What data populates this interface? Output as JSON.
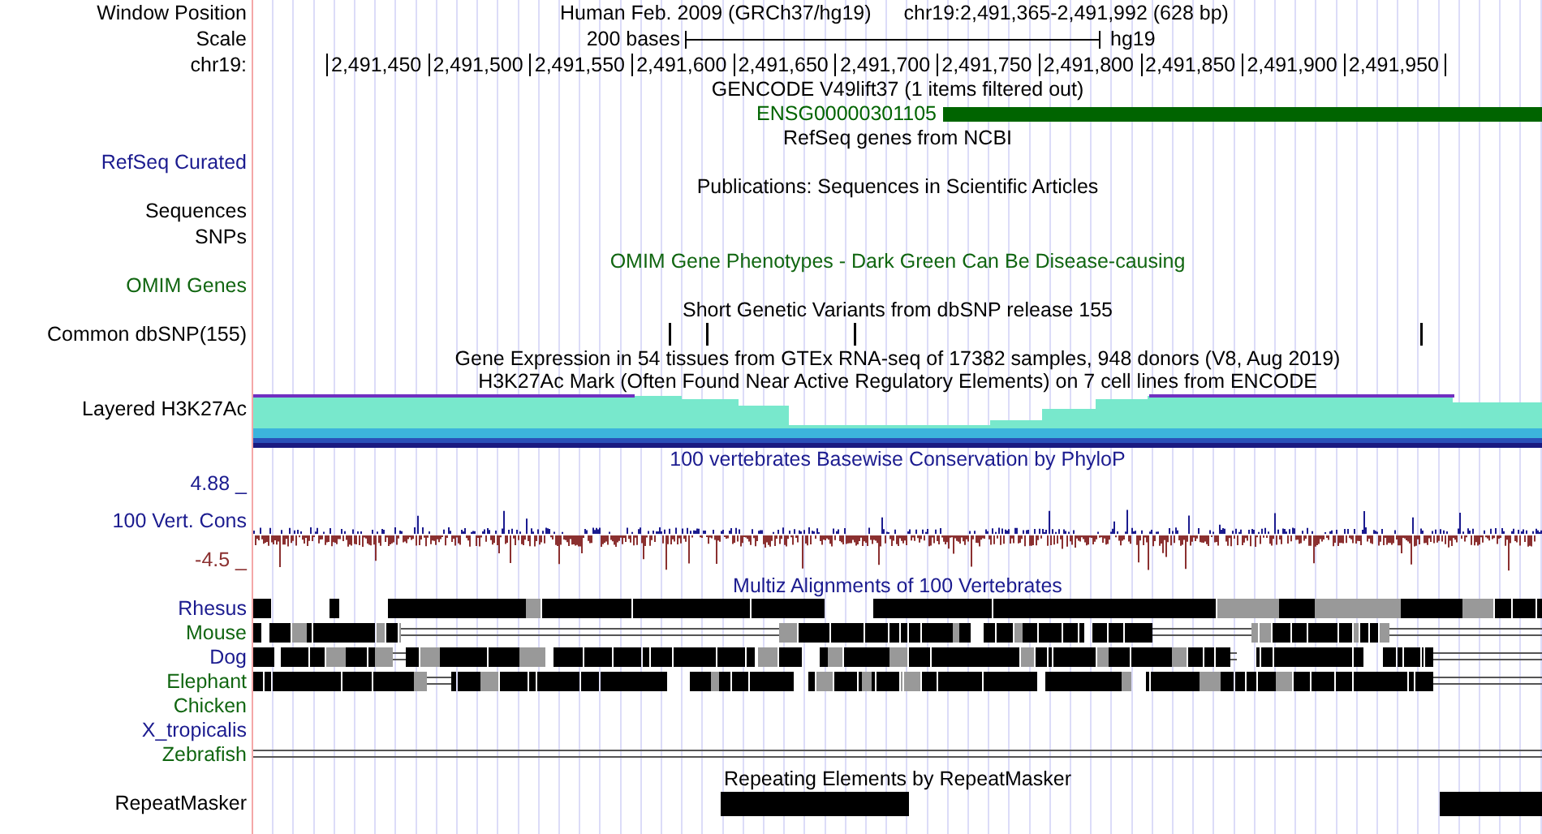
{
  "header": {
    "label": "Window Position",
    "assembly": "Human Feb. 2009 (GRCh37/hg19)",
    "position": "chr19:2,491,365-2,491,992 (628 bp)"
  },
  "scale": {
    "label": "Scale",
    "length": "200 bases",
    "assembly": "hg19"
  },
  "ruler": {
    "label": "chr19:",
    "ticks": [
      "2,491,450",
      "2,491,500",
      "2,491,550",
      "2,491,600",
      "2,491,650",
      "2,491,700",
      "2,491,750",
      "2,491,800",
      "2,491,850",
      "2,491,900",
      "2,491,950"
    ]
  },
  "tracks": [
    {
      "kind": "gene",
      "title": "GENCODE V49lift37 (1 items filtered out)",
      "item": "ENSG00000301105",
      "color": "#006400"
    },
    {
      "kind": "labeled",
      "title": "RefSeq genes from NCBI",
      "labels": [
        {
          "text": "RefSeq Curated",
          "color": "#1b1b8f"
        }
      ]
    },
    {
      "kind": "labeled",
      "title": "Publications: Sequences in Scientific Articles",
      "labels": [
        {
          "text": "Sequences",
          "color": "#000000"
        },
        {
          "text": "SNPs",
          "color": "#000000"
        }
      ]
    },
    {
      "kind": "labeled",
      "title": "OMIM Gene Phenotypes - Dark Green Can Be Disease-causing",
      "color": "#116611",
      "labels": [
        {
          "text": "OMIM Genes",
          "color": "#116611"
        }
      ]
    },
    {
      "kind": "snp",
      "title": "Short Genetic Variants from dbSNP release 155",
      "label": "Common dbSNP(155)"
    },
    {
      "kind": "title",
      "title": "Gene Expression in 54 tissues from GTEx RNA-seq of 17382 samples, 948 donors (V8, Aug 2019)"
    },
    {
      "kind": "density",
      "title": "H3K27Ac Mark (Often Found Near Active Regulatory Elements) on 7 cell lines from ENCODE",
      "label": "Layered H3K27Ac"
    },
    {
      "kind": "wiggle",
      "title": "100 vertebrates Basewise Conservation by PhyloP",
      "label": "100 Vert. Cons",
      "color": "#1b1b8f",
      "max": "4.88 _",
      "min": "-4.5 _"
    },
    {
      "kind": "alignment",
      "title": "Multiz Alignments of 100 Vertebrates",
      "color": "#1b1b8f",
      "species": [
        {
          "name": "Rhesus",
          "color": "#1b1b8f"
        },
        {
          "name": "Mouse",
          "color": "#116611"
        },
        {
          "name": "Dog",
          "color": "#1b1b8f"
        },
        {
          "name": "Elephant",
          "color": "#116611"
        },
        {
          "name": "Chicken",
          "color": "#116611"
        },
        {
          "name": "X_tropicalis",
          "color": "#1b1b8f"
        },
        {
          "name": "Zebrafish",
          "color": "#116611"
        }
      ]
    },
    {
      "kind": "repeat",
      "title": "Repeating Elements by RepeatMasker",
      "label": "RepeatMasker"
    }
  ]
}
